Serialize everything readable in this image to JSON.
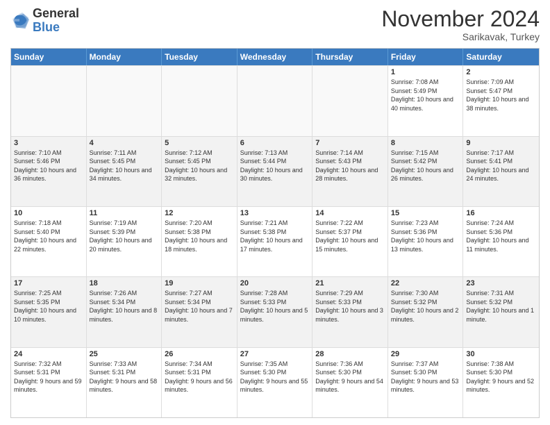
{
  "logo": {
    "general": "General",
    "blue": "Blue"
  },
  "header": {
    "month": "November 2024",
    "location": "Sarikavak, Turkey"
  },
  "days_of_week": [
    "Sunday",
    "Monday",
    "Tuesday",
    "Wednesday",
    "Thursday",
    "Friday",
    "Saturday"
  ],
  "weeks": [
    [
      {
        "day": "",
        "info": ""
      },
      {
        "day": "",
        "info": ""
      },
      {
        "day": "",
        "info": ""
      },
      {
        "day": "",
        "info": ""
      },
      {
        "day": "",
        "info": ""
      },
      {
        "day": "1",
        "info": "Sunrise: 7:08 AM\nSunset: 5:49 PM\nDaylight: 10 hours and 40 minutes."
      },
      {
        "day": "2",
        "info": "Sunrise: 7:09 AM\nSunset: 5:47 PM\nDaylight: 10 hours and 38 minutes."
      }
    ],
    [
      {
        "day": "3",
        "info": "Sunrise: 7:10 AM\nSunset: 5:46 PM\nDaylight: 10 hours and 36 minutes."
      },
      {
        "day": "4",
        "info": "Sunrise: 7:11 AM\nSunset: 5:45 PM\nDaylight: 10 hours and 34 minutes."
      },
      {
        "day": "5",
        "info": "Sunrise: 7:12 AM\nSunset: 5:45 PM\nDaylight: 10 hours and 32 minutes."
      },
      {
        "day": "6",
        "info": "Sunrise: 7:13 AM\nSunset: 5:44 PM\nDaylight: 10 hours and 30 minutes."
      },
      {
        "day": "7",
        "info": "Sunrise: 7:14 AM\nSunset: 5:43 PM\nDaylight: 10 hours and 28 minutes."
      },
      {
        "day": "8",
        "info": "Sunrise: 7:15 AM\nSunset: 5:42 PM\nDaylight: 10 hours and 26 minutes."
      },
      {
        "day": "9",
        "info": "Sunrise: 7:17 AM\nSunset: 5:41 PM\nDaylight: 10 hours and 24 minutes."
      }
    ],
    [
      {
        "day": "10",
        "info": "Sunrise: 7:18 AM\nSunset: 5:40 PM\nDaylight: 10 hours and 22 minutes."
      },
      {
        "day": "11",
        "info": "Sunrise: 7:19 AM\nSunset: 5:39 PM\nDaylight: 10 hours and 20 minutes."
      },
      {
        "day": "12",
        "info": "Sunrise: 7:20 AM\nSunset: 5:38 PM\nDaylight: 10 hours and 18 minutes."
      },
      {
        "day": "13",
        "info": "Sunrise: 7:21 AM\nSunset: 5:38 PM\nDaylight: 10 hours and 17 minutes."
      },
      {
        "day": "14",
        "info": "Sunrise: 7:22 AM\nSunset: 5:37 PM\nDaylight: 10 hours and 15 minutes."
      },
      {
        "day": "15",
        "info": "Sunrise: 7:23 AM\nSunset: 5:36 PM\nDaylight: 10 hours and 13 minutes."
      },
      {
        "day": "16",
        "info": "Sunrise: 7:24 AM\nSunset: 5:36 PM\nDaylight: 10 hours and 11 minutes."
      }
    ],
    [
      {
        "day": "17",
        "info": "Sunrise: 7:25 AM\nSunset: 5:35 PM\nDaylight: 10 hours and 10 minutes."
      },
      {
        "day": "18",
        "info": "Sunrise: 7:26 AM\nSunset: 5:34 PM\nDaylight: 10 hours and 8 minutes."
      },
      {
        "day": "19",
        "info": "Sunrise: 7:27 AM\nSunset: 5:34 PM\nDaylight: 10 hours and 7 minutes."
      },
      {
        "day": "20",
        "info": "Sunrise: 7:28 AM\nSunset: 5:33 PM\nDaylight: 10 hours and 5 minutes."
      },
      {
        "day": "21",
        "info": "Sunrise: 7:29 AM\nSunset: 5:33 PM\nDaylight: 10 hours and 3 minutes."
      },
      {
        "day": "22",
        "info": "Sunrise: 7:30 AM\nSunset: 5:32 PM\nDaylight: 10 hours and 2 minutes."
      },
      {
        "day": "23",
        "info": "Sunrise: 7:31 AM\nSunset: 5:32 PM\nDaylight: 10 hours and 1 minute."
      }
    ],
    [
      {
        "day": "24",
        "info": "Sunrise: 7:32 AM\nSunset: 5:31 PM\nDaylight: 9 hours and 59 minutes."
      },
      {
        "day": "25",
        "info": "Sunrise: 7:33 AM\nSunset: 5:31 PM\nDaylight: 9 hours and 58 minutes."
      },
      {
        "day": "26",
        "info": "Sunrise: 7:34 AM\nSunset: 5:31 PM\nDaylight: 9 hours and 56 minutes."
      },
      {
        "day": "27",
        "info": "Sunrise: 7:35 AM\nSunset: 5:30 PM\nDaylight: 9 hours and 55 minutes."
      },
      {
        "day": "28",
        "info": "Sunrise: 7:36 AM\nSunset: 5:30 PM\nDaylight: 9 hours and 54 minutes."
      },
      {
        "day": "29",
        "info": "Sunrise: 7:37 AM\nSunset: 5:30 PM\nDaylight: 9 hours and 53 minutes."
      },
      {
        "day": "30",
        "info": "Sunrise: 7:38 AM\nSunset: 5:30 PM\nDaylight: 9 hours and 52 minutes."
      }
    ]
  ]
}
